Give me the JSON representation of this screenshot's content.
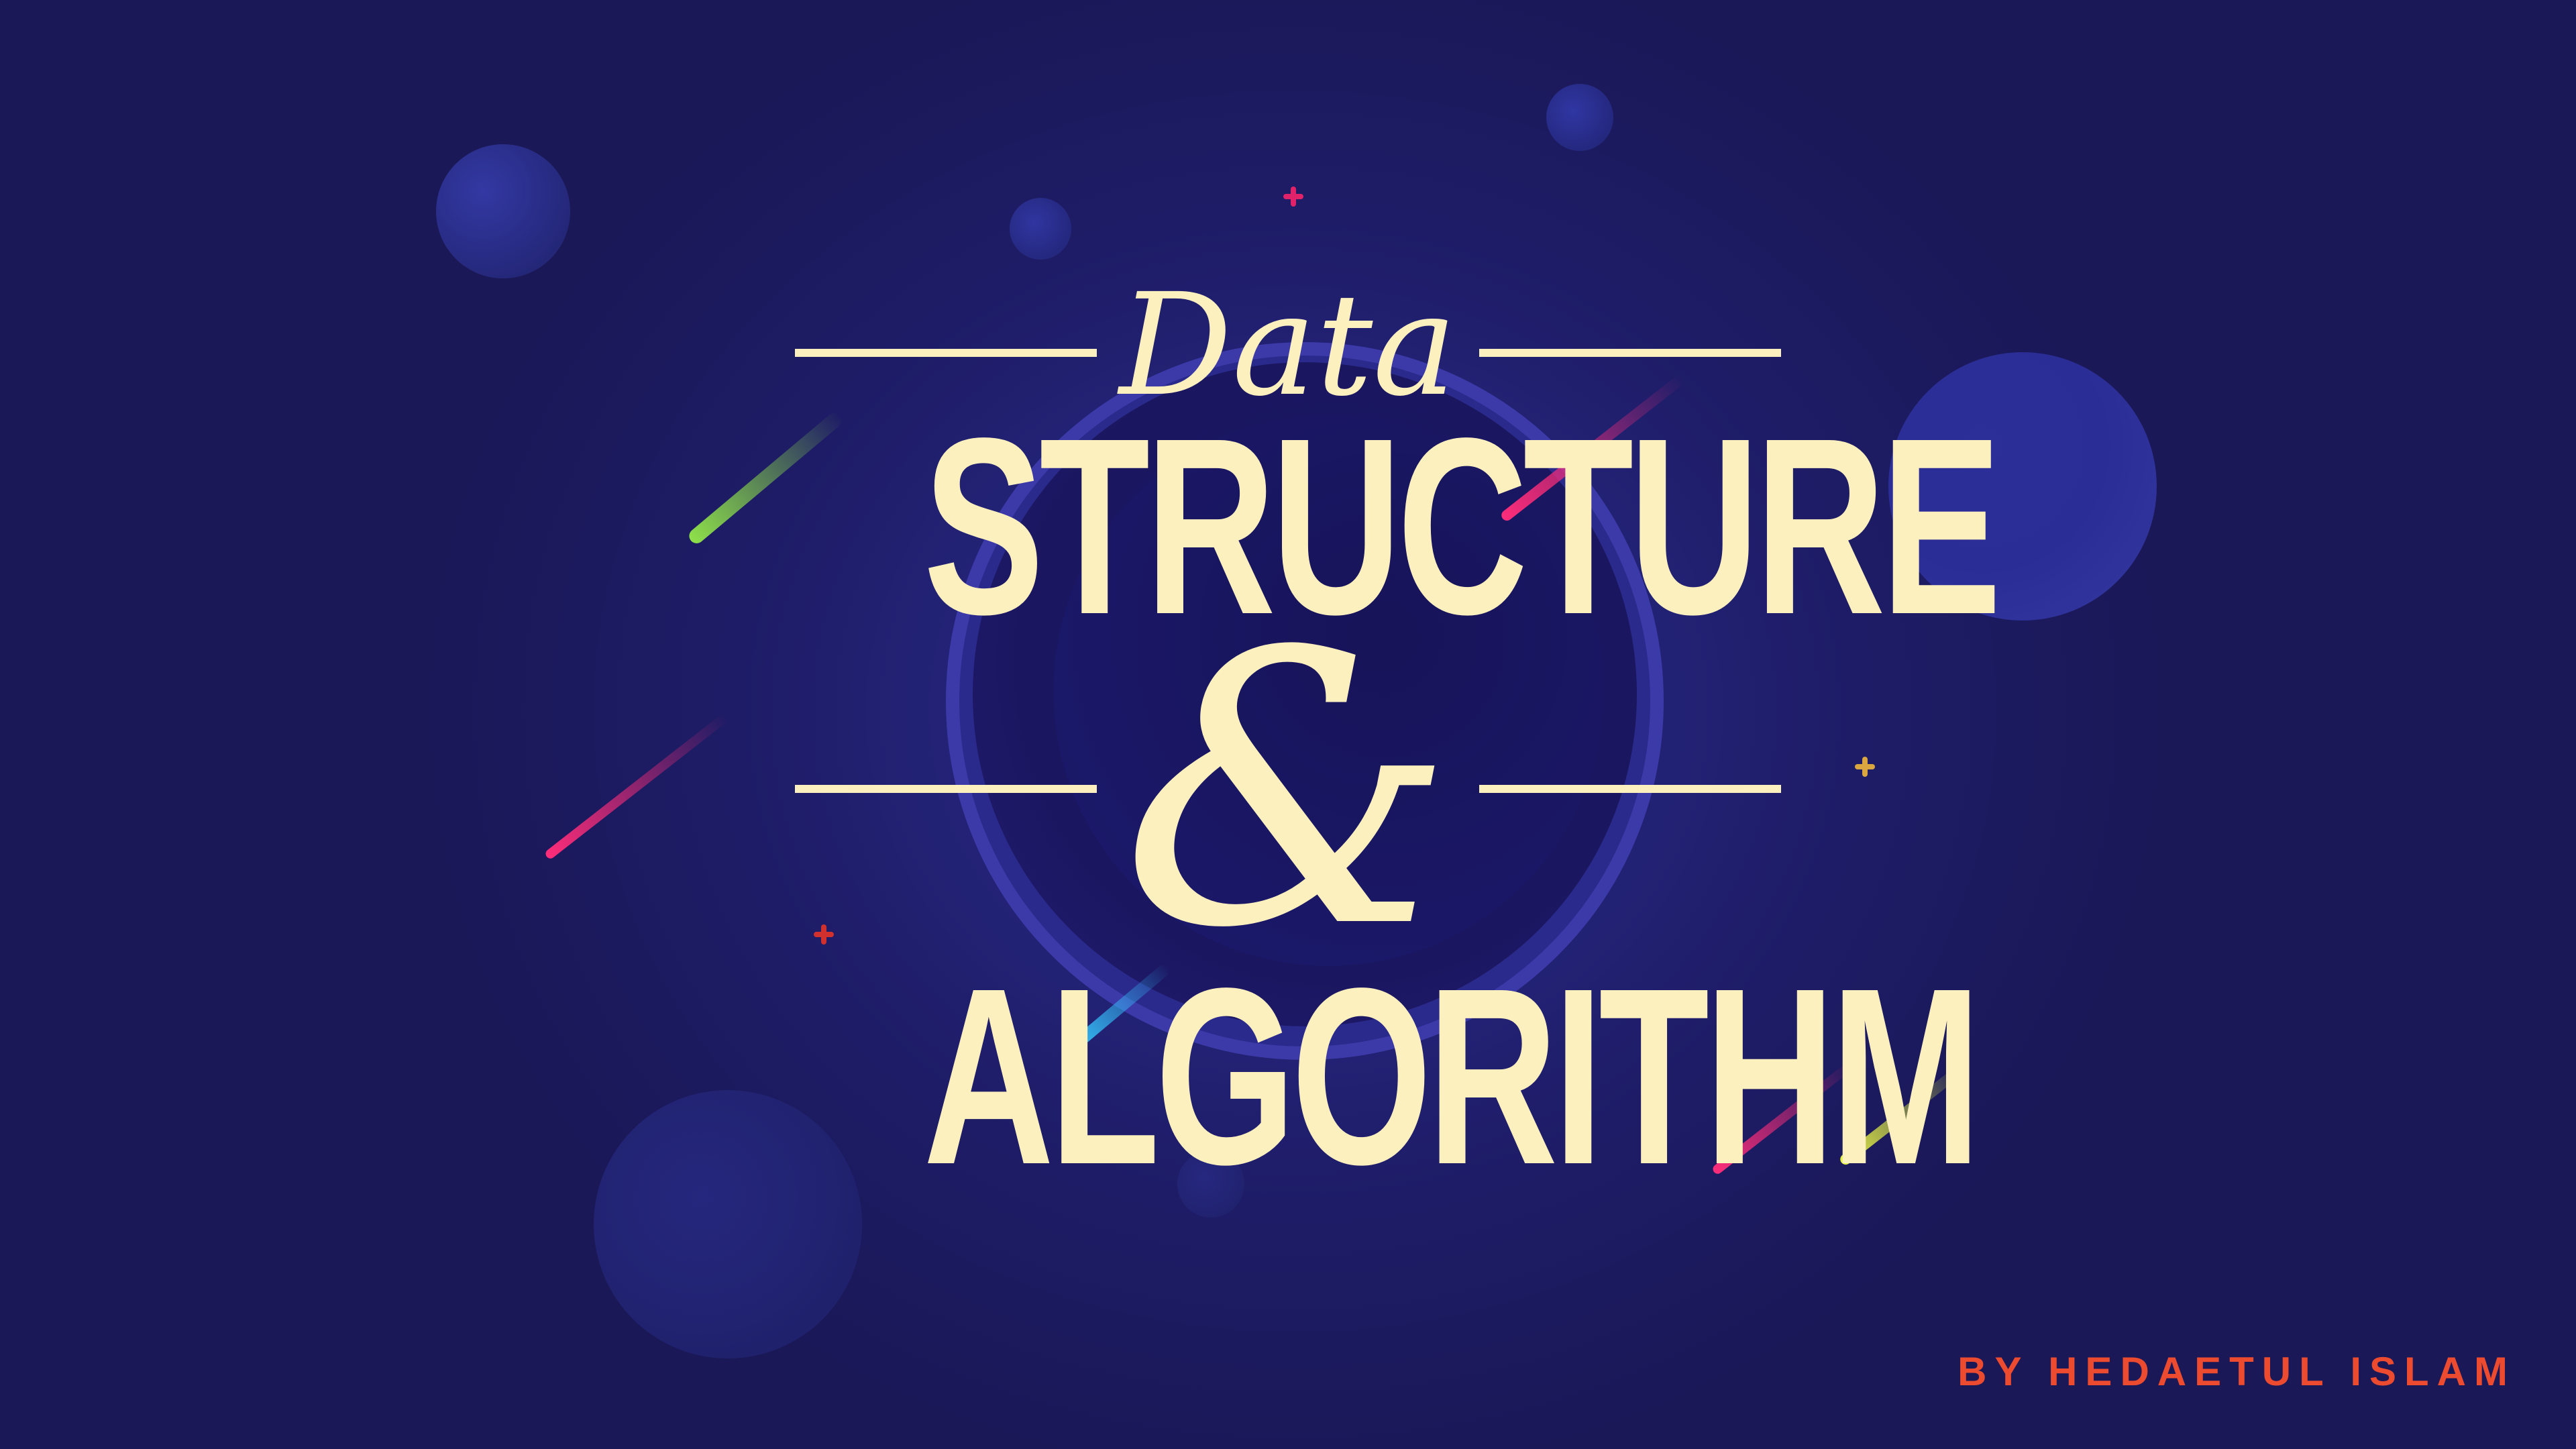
{
  "title": {
    "script_word": "Data",
    "line1": "STRUCTURE",
    "connector": "&",
    "line2": "ALGORITHM"
  },
  "byline": "BY HEDAETUL ISLAM",
  "colors": {
    "background": "#1b1a5a",
    "title_text": "#fdf0bf",
    "byline_text": "#ec4b2f",
    "streak_green": "#8ee04a",
    "streak_pink": "#ff2d7a",
    "streak_cyan": "#35c6ff",
    "streak_yellow": "#e8f542"
  }
}
